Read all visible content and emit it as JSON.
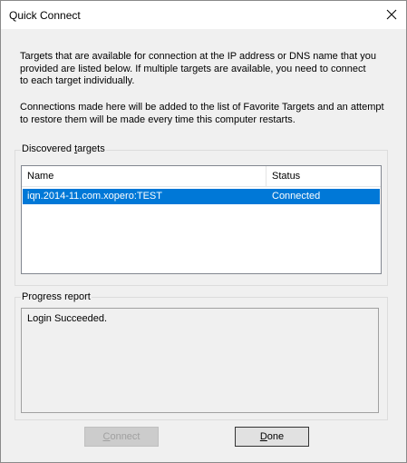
{
  "window": {
    "title": "Quick Connect"
  },
  "intro": {
    "paragraph1_line1": "Targets that are available for connection at the IP address or DNS name that you",
    "paragraph1_line2": "provided are listed below.  If multiple targets are available, you need to connect",
    "paragraph1_line3": "to each target individually.",
    "paragraph2_line1": "Connections made here will be added to the list of Favorite Targets and an attempt",
    "paragraph2_line2": "to restore them will be made every time this computer restarts."
  },
  "discovered": {
    "label_prefix": "Discovered ",
    "label_hotkey": "t",
    "label_suffix": "argets",
    "columns": [
      "Name",
      "Status"
    ],
    "rows": [
      {
        "name": "iqn.2014-11.com.xopero:TEST",
        "status": "Connected",
        "selected": true
      }
    ]
  },
  "progress": {
    "label": "Progress report",
    "text": "Login Succeeded."
  },
  "buttons": {
    "connect_hotkey": "C",
    "connect_rest": "onnect",
    "connect_enabled": false,
    "done_hotkey": "D",
    "done_rest": "one"
  },
  "colors": {
    "selection": "#0078d7",
    "window_bg": "#f0f0f0"
  }
}
